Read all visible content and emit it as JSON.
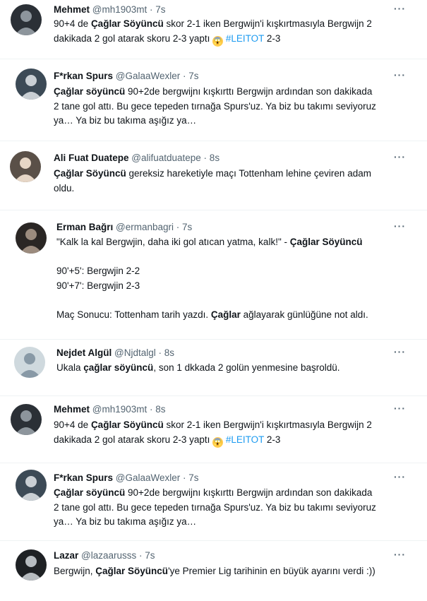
{
  "tweets": [
    {
      "name": "Mehmet",
      "handle": "@mh1903mt · 7s",
      "lines": [
        {
          "pre": "90+4 de ",
          "bold": "Çağlar Söyüncü",
          "post": " skor 2-1 iken Bergwijn'i kışkırtmasıyla Bergwijn 2"
        },
        {
          "pre": "dakikada 2 gol atarak skoru 2-3 yaptı ",
          "emoji": "😱",
          "hash": " #LEITOT",
          "post": " 2-3"
        }
      ]
    },
    {
      "name": "F*rkan Spurs",
      "handle": "@GalaaWexler · 7s",
      "lines": [
        {
          "bold": "Çağlar söyüncü",
          "post": " 90+2de bergwijnı kışkırttı Bergwijn ardından son dakikada"
        },
        {
          "pre": "2 tane gol attı. Bu gece tepeden tırnağa Spurs'uz. Ya biz bu takımı seviyoruz"
        },
        {
          "pre": "ya… Ya biz bu takıma aşığız ya…"
        }
      ]
    },
    {
      "name": "Ali Fuat Duatepe",
      "handle": "@alifuatduatepe · 8s",
      "lines": [
        {
          "bold": "Çağlar Söyüncü",
          "post": " gereksiz hareketiyle maçı Tottenham lehine çeviren adam"
        },
        {
          "pre": "oldu."
        }
      ]
    },
    {
      "name": "Erman Bağrı",
      "handle": "@ermanbagri · 7s",
      "lines": [
        {
          "pre": "\"Kalk la kal Bergwjin, daha iki gol atıcan yatma, kalk!\" - ",
          "bold": "Çağlar Söyüncü"
        },
        {
          "pre": ""
        },
        {
          "pre": "90'+5': Bergwjin 2-2"
        },
        {
          "pre": "90'+7': Bergwjin 2-3"
        },
        {
          "pre": ""
        },
        {
          "pre": "Maç Sonucu: Tottenham tarih yazdı. ",
          "bold": "Çağlar",
          "post": " ağlayarak günlüğüne not aldı."
        }
      ]
    },
    {
      "name": "Nejdet Algül",
      "handle": "@Njdtalgl · 8s",
      "lines": [
        {
          "pre": "Ukala ",
          "bold": "çağlar söyüncü",
          "post": ", son 1 dkkada 2 golün yenmesine başroldü."
        }
      ]
    },
    {
      "name": "Mehmet",
      "handle": "@mh1903mt · 8s",
      "lines": [
        {
          "pre": "90+4 de ",
          "bold": "Çağlar Söyüncü",
          "post": " skor 2-1 iken Bergwijn'i kışkırtmasıyla Bergwijn 2"
        },
        {
          "pre": "dakikada 2 gol atarak skoru 2-3 yaptı ",
          "emoji": "😱",
          "hash": " #LEITOT",
          "post": " 2-3"
        }
      ]
    },
    {
      "name": "F*rkan Spurs",
      "handle": "@GalaaWexler · 7s",
      "lines": [
        {
          "bold": "Çağlar söyüncü",
          "post": " 90+2de bergwijnı kışkırttı Bergwijn ardından son dakikada"
        },
        {
          "pre": "2 tane gol attı. Bu gece tepeden tırnağa Spurs'uz. Ya biz bu takımı seviyoruz"
        },
        {
          "pre": "ya… Ya biz bu takıma aşığız ya…"
        }
      ]
    },
    {
      "name": "Lazar",
      "handle": "@lazaarusss · 7s",
      "lines": [
        {
          "pre": "Bergwijn, ",
          "bold": "Çağlar Söyüncü",
          "post": "'ye Premier Lig tarihinin en büyük ayarını verdi :))"
        }
      ]
    }
  ],
  "more_label": "···",
  "icons": {
    "more": "more-options-icon",
    "avatar": "profile-avatar"
  },
  "colors": {
    "link": "#1d9bf0",
    "secondary": "#536471"
  }
}
